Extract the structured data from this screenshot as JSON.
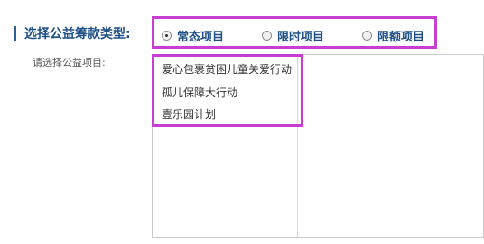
{
  "section": {
    "title": "选择公益筹款类型:"
  },
  "radio_options": [
    {
      "label": "常态项目",
      "checked": true
    },
    {
      "label": "限时项目",
      "checked": false
    },
    {
      "label": "限额项目",
      "checked": false
    }
  ],
  "project_select": {
    "label": "请选择公益项目:",
    "items": [
      "爱心包裹贫困儿童关爱行动",
      "孤儿保障大行动",
      "壹乐园计划"
    ]
  },
  "colors": {
    "accent_text": "#1d4f86",
    "highlight_border": "#c83ed0"
  }
}
